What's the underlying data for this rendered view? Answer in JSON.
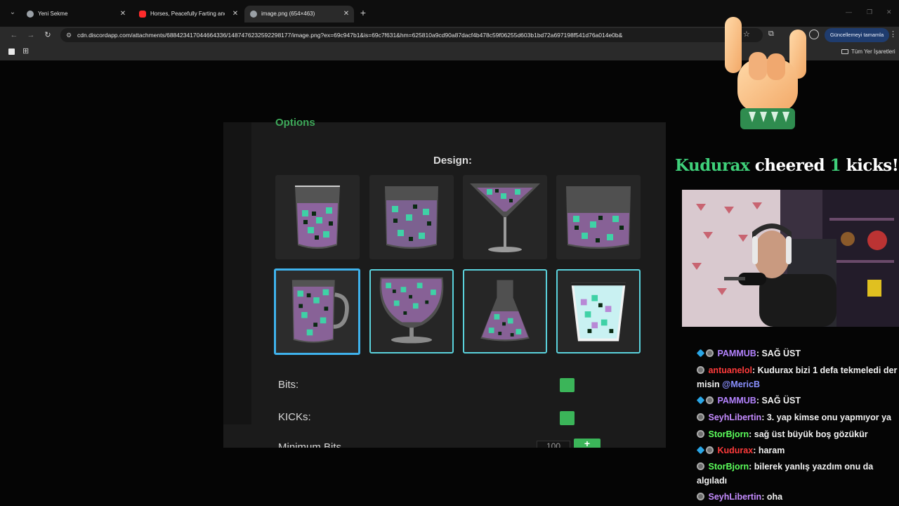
{
  "browser": {
    "tabs": [
      {
        "label": "Yeni Sekme",
        "favicon_color": "#9aa0a6"
      },
      {
        "label": "Horses, Peacefully Farting and ",
        "favicon_color": "#ff2b2b"
      },
      {
        "label": "image.png (654×463)",
        "favicon_color": "#9aa0a6"
      }
    ],
    "url": "cdn.discordapp.com/attachments/688423417044664336/1487476232592298177/image.png?ex=69c947b1&is=69c7f631&hm=625810a9cd90a87dacf4b478c59f06255d603b1bd72a697198f541d76a014e0b&",
    "update_button": "Güncellemeyi tamamla",
    "bookmarks_all": "Tüm Yer İşaretleri",
    "icons": [
      "tab-search-icon",
      "back-icon",
      "forward-icon",
      "reload-icon",
      "site-info-icon",
      "bookmark-star-icon",
      "extensions-icon",
      "profile-icon",
      "menu-icon",
      "apps-icon",
      "folder-icon"
    ]
  },
  "options_panel": {
    "title": "Options",
    "design_label": "Design:",
    "designs": [
      {
        "name": "tumbler"
      },
      {
        "name": "wide-glass"
      },
      {
        "name": "martini-glass"
      },
      {
        "name": "large-jar"
      },
      {
        "name": "beer-mug",
        "selected": true
      },
      {
        "name": "snifter"
      },
      {
        "name": "flask"
      },
      {
        "name": "paper-cup"
      }
    ],
    "rows": [
      {
        "label": "Bits:",
        "enabled": true
      },
      {
        "label": "KICKs:",
        "enabled": true
      }
    ],
    "cut_row_label": "Minimum Bits",
    "cut_row_value": "100",
    "plus_label": "+",
    "colors": {
      "accent": "#3ea95a",
      "selected_border": "#3fb2ec",
      "card_border": "#5ad2dc"
    }
  },
  "overlay": {
    "cheer": {
      "user": "Kudurax",
      "word1": "cheered",
      "count": "1",
      "word2": "kicks!"
    }
  },
  "chat": [
    {
      "user": "PAMMUB",
      "color": "#b483ff",
      "text": ": SAĞ ÜST",
      "sub": true
    },
    {
      "user": "antuanelol",
      "color": "#ff3b3b",
      "text": ": Kudurax bizi 1 defa tekmeledi der misin ",
      "mention": "@MericB",
      "sub": false
    },
    {
      "user": "PAMMUB",
      "color": "#b483ff",
      "text": ": SAĞ ÜST",
      "sub": true
    },
    {
      "user": "SeyhLibertin",
      "color": "#c58cff",
      "text": ": 3. yap kimse onu yapmıyor ya",
      "sub": false
    },
    {
      "user": "StorBjorn",
      "color": "#5cff5c",
      "text": ": sağ üst büyük boş gözükür",
      "sub": false
    },
    {
      "user": "Kudurax",
      "color": "#ff3b3b",
      "text": ": haram",
      "sub": true
    },
    {
      "user": "StorBjorn",
      "color": "#5cff5c",
      "text": ": bilerek yanlış yazdım onu da algıladı",
      "sub": false
    },
    {
      "user": "SeyhLibertin",
      "color": "#c58cff",
      "text": ": oha",
      "sub": false
    }
  ]
}
